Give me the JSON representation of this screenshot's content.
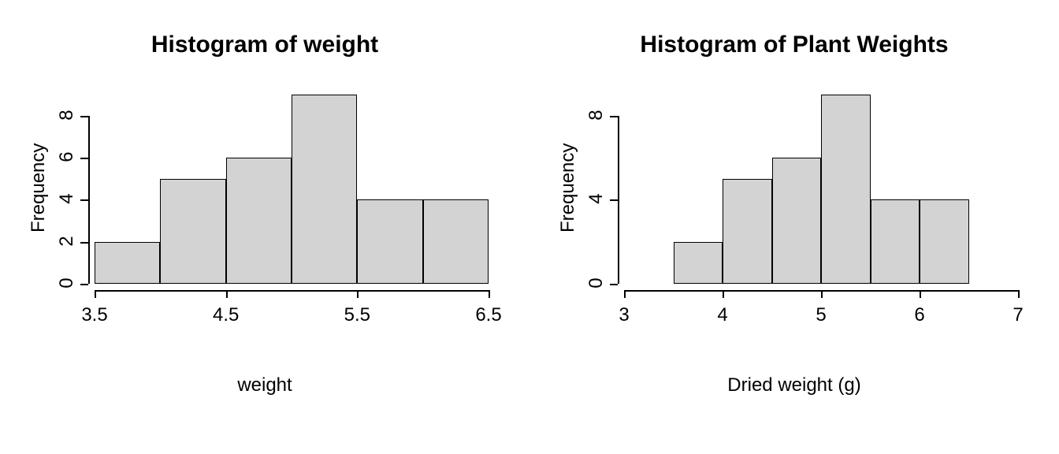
{
  "chart_data": [
    {
      "type": "bar",
      "title": "Histogram of weight",
      "xlabel": "weight",
      "ylabel": "Frequency",
      "categories": [
        "3.5–4.0",
        "4.0–4.5",
        "4.5–5.0",
        "5.0–5.5",
        "5.5–6.0",
        "6.0–6.5"
      ],
      "bin_edges": [
        3.5,
        4.0,
        4.5,
        5.0,
        5.5,
        6.0,
        6.5
      ],
      "values": [
        2,
        5,
        6,
        9,
        4,
        4
      ],
      "x_ticks": [
        3.5,
        4.5,
        5.5,
        6.5
      ],
      "y_ticks": [
        0,
        2,
        4,
        6,
        8
      ],
      "xlim": [
        3.5,
        6.5
      ],
      "ylim": [
        0,
        9
      ]
    },
    {
      "type": "bar",
      "title": "Histogram of Plant Weights",
      "xlabel": "Dried weight (g)",
      "ylabel": "Frequency",
      "categories": [
        "3.5–4.0",
        "4.0–4.5",
        "4.5–5.0",
        "5.0–5.5",
        "5.5–6.0",
        "6.0–6.5"
      ],
      "bin_edges": [
        3.5,
        4.0,
        4.5,
        5.0,
        5.5,
        6.0,
        6.5
      ],
      "values": [
        2,
        5,
        6,
        9,
        4,
        4
      ],
      "x_ticks": [
        3,
        4,
        5,
        6,
        7
      ],
      "y_ticks": [
        0,
        4,
        8
      ],
      "xlim": [
        3,
        7
      ],
      "ylim": [
        0,
        9
      ]
    }
  ]
}
